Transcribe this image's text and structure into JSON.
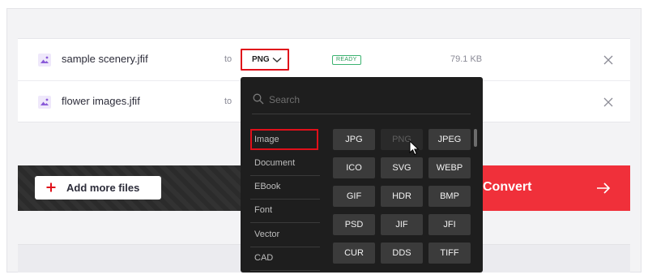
{
  "files": [
    {
      "name": "sample scenery.jfif",
      "to_label": "to",
      "format": "PNG",
      "status": "READY",
      "size": "79.1 KB"
    },
    {
      "name": "flower images.jfif",
      "to_label": "to"
    }
  ],
  "actions": {
    "add_more_label": "Add more files",
    "convert_label": "Convert"
  },
  "dropdown": {
    "search_placeholder": "Search",
    "categories": [
      "Image",
      "Document",
      "EBook",
      "Font",
      "Vector",
      "CAD"
    ],
    "active_category": "Image",
    "formats": [
      "JPG",
      "PNG",
      "JPEG",
      "ICO",
      "SVG",
      "WEBP",
      "GIF",
      "HDR",
      "BMP",
      "PSD",
      "JIF",
      "JFI",
      "CUR",
      "DDS",
      "TIFF"
    ],
    "disabled_format": "PNG"
  },
  "colors": {
    "accent_red": "#f0303a",
    "ready_green": "#2e9d5c",
    "dropdown_bg": "#1e1e1e"
  },
  "icons": [
    "image-file-icon",
    "chevron-down-icon",
    "close-icon",
    "plus-icon",
    "arrow-right-icon",
    "search-icon",
    "mouse-cursor-icon"
  ]
}
